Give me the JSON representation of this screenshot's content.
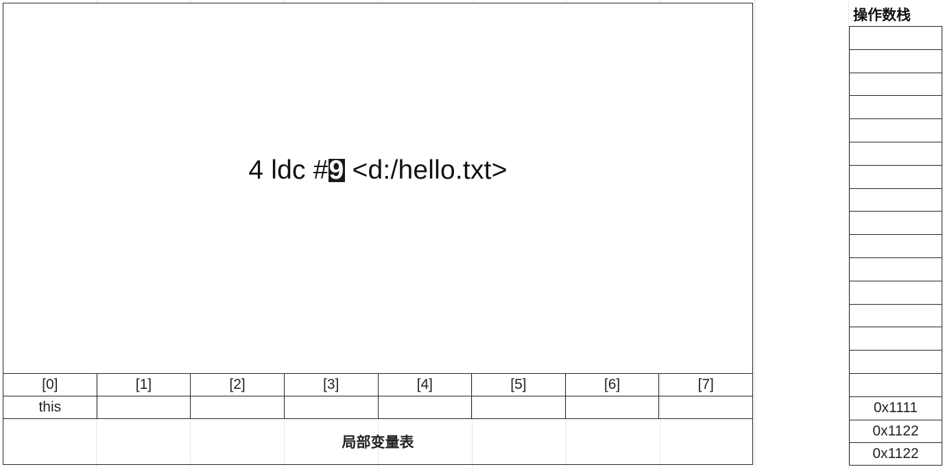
{
  "frame": {
    "instruction_prefix": "4 ldc #",
    "instruction_highlight": "9",
    "instruction_suffix": " <d:/hello.txt>"
  },
  "local_variable_table": {
    "indices": [
      "[0]",
      "[1]",
      "[2]",
      "[3]",
      "[4]",
      "[5]",
      "[6]",
      "[7]"
    ],
    "values": [
      "this",
      "",
      "",
      "",
      "",
      "",
      "",
      ""
    ],
    "caption": "局部变量表"
  },
  "operand_stack": {
    "title": "操作数栈",
    "slots": [
      "",
      "",
      "",
      "",
      "",
      "",
      "",
      "",
      "",
      "",
      "",
      "",
      "",
      "",
      "",
      "",
      "0x1111",
      "0x1122",
      "0x1122"
    ]
  }
}
